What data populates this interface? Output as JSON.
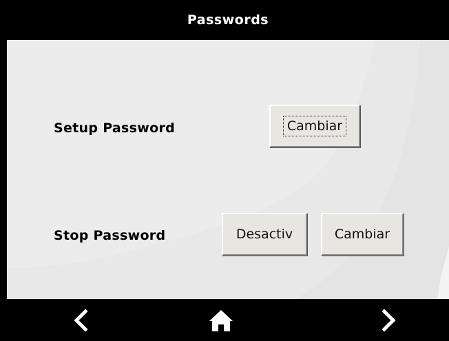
{
  "header": {
    "title": "Passwords"
  },
  "rows": {
    "setup": {
      "label": "Setup Password",
      "change_button": "Cambiar"
    },
    "stop": {
      "label": "Stop Password",
      "deactivate_button": "Desactiv",
      "change_button": "Cambiar"
    }
  },
  "navigation": {
    "back_icon": "chevron-left-icon",
    "home_icon": "home-icon",
    "forward_icon": "chevron-right-icon"
  },
  "colors": {
    "header_bg": "#000000",
    "content_bg": "#eaeaea",
    "button_bg": "#e8e6e0"
  }
}
